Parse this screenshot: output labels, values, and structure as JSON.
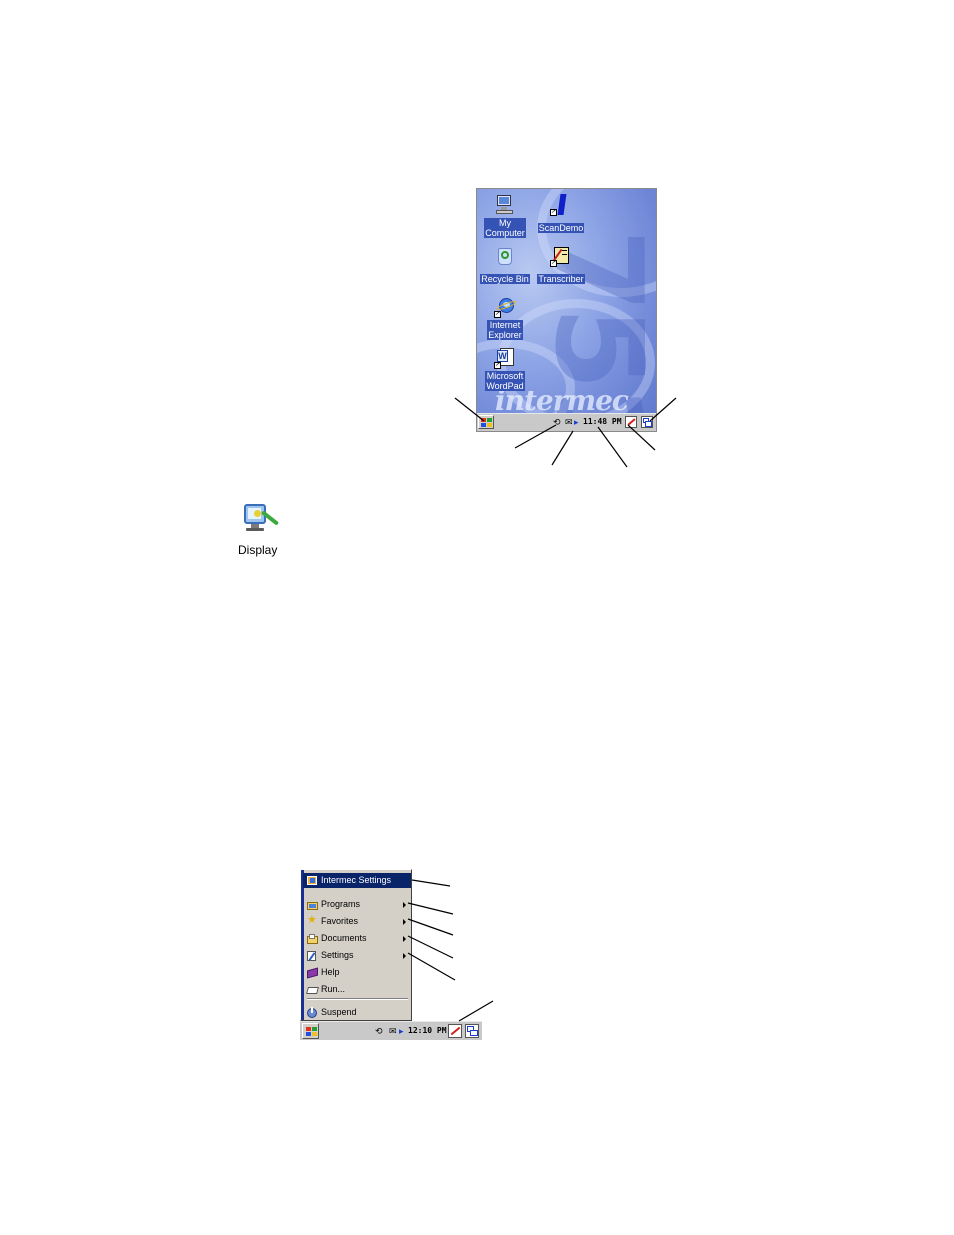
{
  "desktop": {
    "brand": "intermec",
    "background_numeral": "751",
    "icons": [
      {
        "label_line1": "My",
        "label_line2": "Computer",
        "icon": "my-computer-icon"
      },
      {
        "label_line1": "ScanDemo",
        "label_line2": "",
        "icon": "scandemo-icon"
      },
      {
        "label_line1": "Recycle Bin",
        "label_line2": "",
        "icon": "recycle-bin-icon"
      },
      {
        "label_line1": "Transcriber",
        "label_line2": "",
        "icon": "transcriber-icon"
      },
      {
        "label_line1": "Internet",
        "label_line2": "Explorer",
        "icon": "internet-explorer-icon"
      },
      {
        "label_line1": "Microsoft",
        "label_line2": "WordPad",
        "icon": "wordpad-icon"
      }
    ],
    "taskbar": {
      "clock": "11:48 PM",
      "sync_glyph": "⟲",
      "mail_glyph": "✉",
      "arrow_glyph": "▸"
    }
  },
  "control_panel_icon": {
    "label": "Display",
    "icon": "display-icon"
  },
  "start_menu": {
    "items": [
      {
        "label": "Intermec Settings",
        "icon": "intermec-settings-icon",
        "selected": true,
        "submenu": false
      },
      {
        "label": "Programs",
        "icon": "programs-folder-icon",
        "selected": false,
        "submenu": true
      },
      {
        "label": "Favorites",
        "icon": "favorites-star-icon",
        "selected": false,
        "submenu": true
      },
      {
        "label": "Documents",
        "icon": "documents-folder-icon",
        "selected": false,
        "submenu": true
      },
      {
        "label": "Settings",
        "icon": "settings-icon",
        "selected": false,
        "submenu": true
      },
      {
        "label": "Help",
        "icon": "help-book-icon",
        "selected": false,
        "submenu": false
      },
      {
        "label": "Run...",
        "icon": "run-icon",
        "selected": false,
        "submenu": false
      },
      {
        "label": "Suspend",
        "icon": "suspend-icon",
        "selected": false,
        "submenu": false
      }
    ],
    "taskbar": {
      "clock": "12:10 PM",
      "sync_glyph": "⟲",
      "mail_glyph": "✉",
      "arrow_glyph": "▸"
    }
  },
  "colors": {
    "menu_highlight": "#0a246a",
    "desktop_label_bg": "#3553b5",
    "taskbar_bg": "#c9c9c9"
  }
}
